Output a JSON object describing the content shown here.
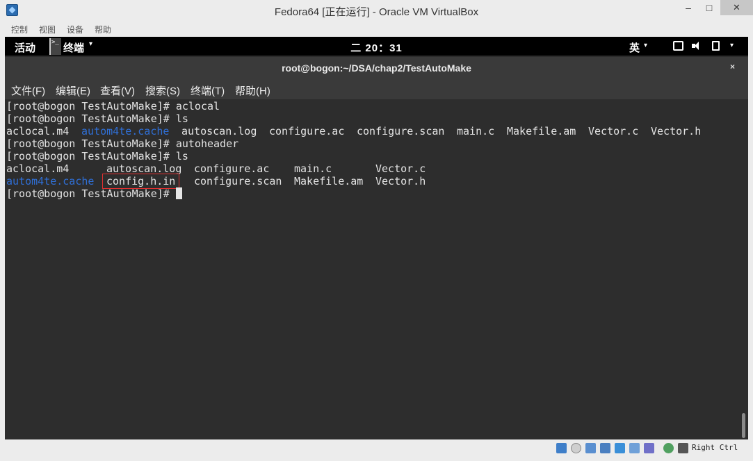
{
  "host_window": {
    "title": "Fedora64 [正在运行] - Oracle VM VirtualBox",
    "minimize_glyph": "–",
    "maximize_glyph": "□",
    "close_glyph": "✕",
    "menu": [
      "控制",
      "视图",
      "设备",
      "帮助"
    ]
  },
  "gnome_topbar": {
    "activities": "活动",
    "app_name": "终端",
    "app_caret": "▾",
    "clock": "二 20：31",
    "input_method": "英",
    "input_caret": "▾",
    "system_caret": "▾"
  },
  "terminal_window": {
    "title": "root@bogon:~/DSA/chap2/TestAutoMake",
    "close_glyph": "×",
    "menu": [
      "文件(F)",
      "编辑(E)",
      "查看(V)",
      "搜索(S)",
      "终端(T)",
      "帮助(H)"
    ]
  },
  "terminal": {
    "prompt": "[root@bogon TestAutoMake]# ",
    "commands": {
      "c1": "aclocal",
      "c2": "ls",
      "c3": "autoheader",
      "c4": "ls",
      "c5": ""
    },
    "ls1": {
      "f1": "aclocal.m4",
      "f2": "autom4te.cache",
      "f3": "autoscan.log",
      "f4": "configure.ac",
      "f5": "configure.scan",
      "f6": "main.c",
      "f7": "Makefile.am",
      "f8": "Vector.c",
      "f9": "Vector.h"
    },
    "ls2_row1": {
      "f1": "aclocal.m4",
      "f2": "autoscan.log",
      "f3": "configure.ac",
      "f4": "main.c",
      "f5": "Vector.c"
    },
    "ls2_row2": {
      "f1": "autom4te.cache",
      "f2": "config.h.in",
      "f3": "configure.scan",
      "f4": "Makefile.am",
      "f5": "Vector.h"
    },
    "dir_color": "#2f6fd6",
    "highlight_color": "#e03030"
  },
  "statusbar": {
    "host_key": "Right Ctrl",
    "icons": [
      "hard-disk-icon",
      "optical-drive-icon",
      "usb-icon",
      "network-icon",
      "shared-folders-icon",
      "display-icon",
      "video-capture-icon",
      "cpu-icon",
      "guest-additions-icon",
      "mouse-integration-icon"
    ]
  }
}
